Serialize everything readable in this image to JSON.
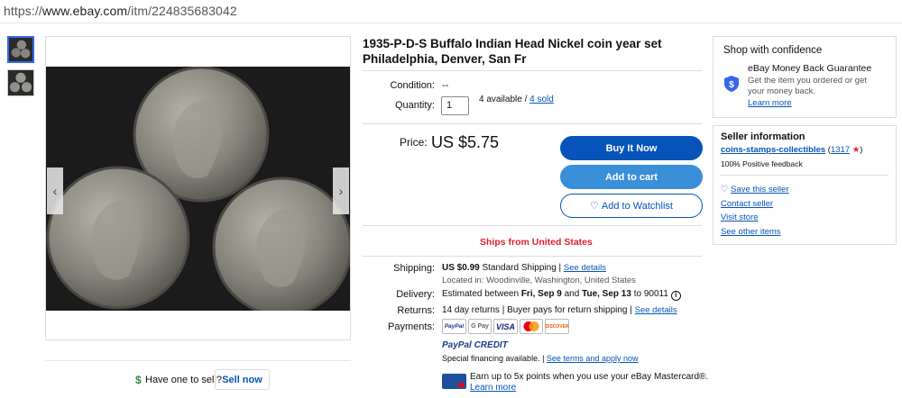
{
  "browser": {
    "url_prefix": "https://",
    "url_host": "www.ebay.com",
    "url_path": "/itm/224835683042"
  },
  "gallery": {
    "prev_icon": "‹",
    "next_icon": "›"
  },
  "title": "1935-P-D-S Buffalo Indian Head Nickel coin year set Philadelphia, Denver, San Fr",
  "condition": {
    "label": "Condition:",
    "value": "--"
  },
  "quantity": {
    "label": "Quantity:",
    "value": "1",
    "available": "4 available / ",
    "sold": "4 sold"
  },
  "price": {
    "label": "Price:",
    "value": "US $5.75"
  },
  "buttons": {
    "buy": "Buy It Now",
    "cart": "Add to cart",
    "watch": "Add to Watchlist"
  },
  "ships_from": "Ships from United States",
  "shipping": {
    "label": "Shipping:",
    "cost": "US $0.99",
    "service": " Standard Shipping | ",
    "details_link": "See details",
    "location": "Located in: Woodinville, Washington, United States"
  },
  "delivery": {
    "label": "Delivery:",
    "prefix": "Estimated between ",
    "start": "Fri, Sep 9",
    "and": " and ",
    "end": "Tue, Sep 13",
    "zip": " to 90011"
  },
  "returns": {
    "label": "Returns:",
    "text": "14 day returns | Buyer pays for return shipping | ",
    "link": "See details"
  },
  "payments": {
    "label": "Payments:",
    "methods": [
      "PayPal",
      "G Pay",
      "VISA",
      "MC",
      "DISCOVER"
    ],
    "paypal_credit": "PayPal CREDIT",
    "financing": "Special financing available. | ",
    "financing_link": "See terms and apply now",
    "mastercard_offer": "Earn up to 5x points when you use your eBay Mastercard®.",
    "learn_more": "Learn more"
  },
  "confidence": {
    "heading": "Shop with confidence",
    "guarantee_title": "eBay Money Back Guarantee",
    "guarantee_text": "Get the item you ordered or get your money back.",
    "learn_more": "Learn more"
  },
  "seller": {
    "heading": "Seller information",
    "name": "coins-stamps-collectibles",
    "score_open": " (",
    "score": "1317",
    "score_close": ")",
    "feedback": "100% Positive feedback",
    "save": "Save this seller",
    "contact": "Contact seller",
    "store": "Visit store",
    "other": "See other items"
  },
  "sell": {
    "dollar": "$",
    "prompt": "Have one to sell?",
    "button": "Sell now"
  }
}
